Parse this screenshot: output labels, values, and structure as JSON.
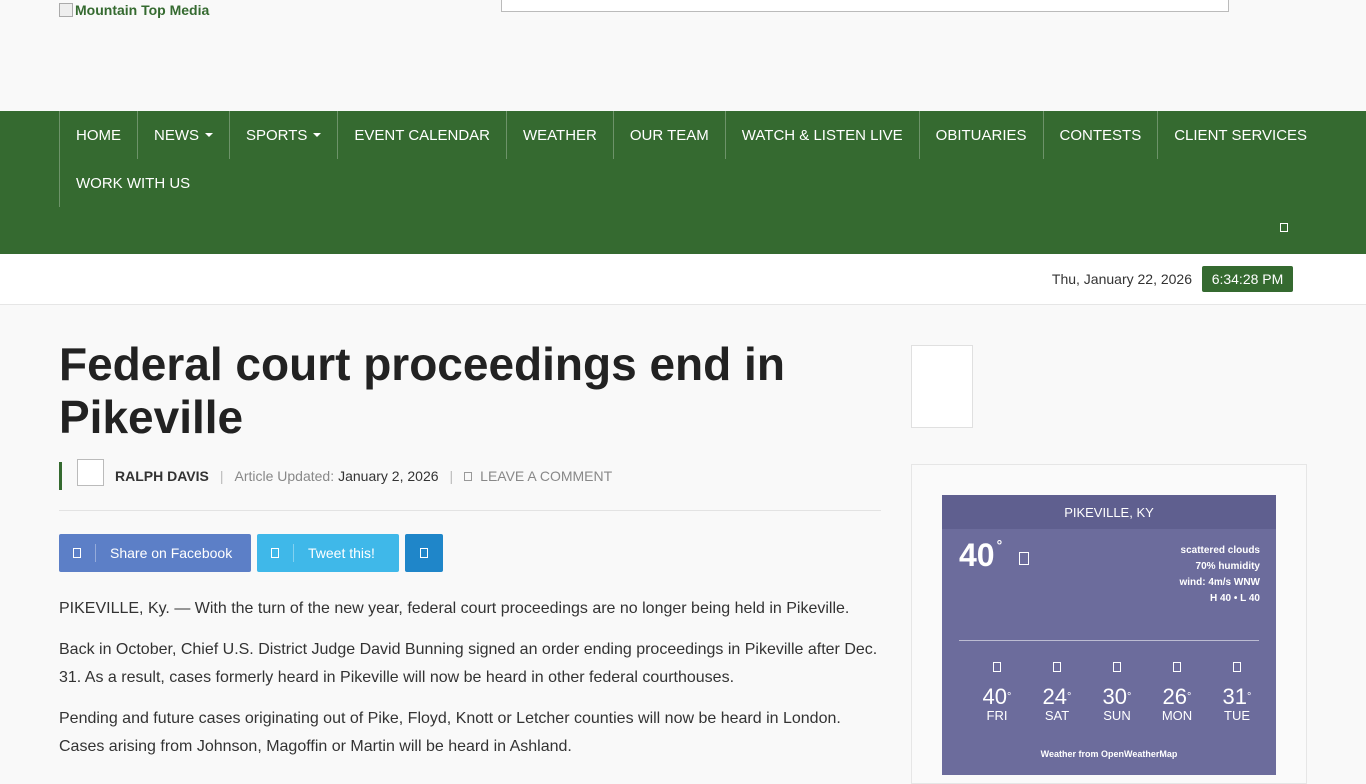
{
  "header": {
    "logo_text": "Mountain Top Media"
  },
  "nav": {
    "row1": [
      {
        "label": "HOME",
        "dropdown": false
      },
      {
        "label": "NEWS",
        "dropdown": true
      },
      {
        "label": "SPORTS",
        "dropdown": true
      },
      {
        "label": "EVENT CALENDAR",
        "dropdown": false
      },
      {
        "label": "WEATHER",
        "dropdown": false
      },
      {
        "label": "OUR TEAM",
        "dropdown": false
      },
      {
        "label": "WATCH & LISTEN LIVE",
        "dropdown": false
      },
      {
        "label": "OBITUARIES",
        "dropdown": false
      },
      {
        "label": "CONTESTS",
        "dropdown": false
      },
      {
        "label": "CLIENT SERVICES",
        "dropdown": false
      }
    ],
    "row2": [
      {
        "label": "WORK WITH US",
        "dropdown": false
      }
    ],
    "search_icon": "search-icon"
  },
  "datebar": {
    "date": "Thu, January 22, 2026",
    "time": "6:34:28 PM"
  },
  "article": {
    "title": "Federal court proceedings end in Pikeville",
    "author": "RALPH DAVIS",
    "updated_label": "Article Updated:",
    "updated_date": "January 2, 2026",
    "comment_label": "LEAVE A COMMENT",
    "share": {
      "facebook": "Share on Facebook",
      "twitter": "Tweet this!"
    },
    "paragraphs": [
      "PIKEVILLE, Ky. — With the turn of the new year, federal court proceedings are no longer being held in Pikeville.",
      "Back in October, Chief U.S. District Judge David Bunning signed an order ending proceedings in Pikeville after Dec. 31. As a result, cases formerly heard in Pikeville will now be heard in other federal courthouses.",
      "Pending and future cases originating out of Pike, Floyd, Knott or Letcher counties will now be heard in London. Cases arising from Johnson, Magoffin or Martin will be heard in Ashland."
    ]
  },
  "weather": {
    "location": "PIKEVILLE, KY",
    "current_temp": "40",
    "degree": "°",
    "description": "scattered clouds",
    "humidity": "70% humidity",
    "wind": "wind: 4m/s WNW",
    "hilo": "H 40 • L 40",
    "forecast": [
      {
        "temp": "40",
        "day": "FRI"
      },
      {
        "temp": "24",
        "day": "SAT"
      },
      {
        "temp": "30",
        "day": "SUN"
      },
      {
        "temp": "26",
        "day": "MON"
      },
      {
        "temp": "31",
        "day": "TUE"
      }
    ],
    "credit": "Weather from OpenWeatherMap"
  },
  "colors": {
    "brand_green": "#356a30",
    "facebook": "#5c7fc7",
    "twitter": "#3fb8e9",
    "linkedin": "#1f86c9",
    "weather_bg": "#6c6c9c"
  }
}
